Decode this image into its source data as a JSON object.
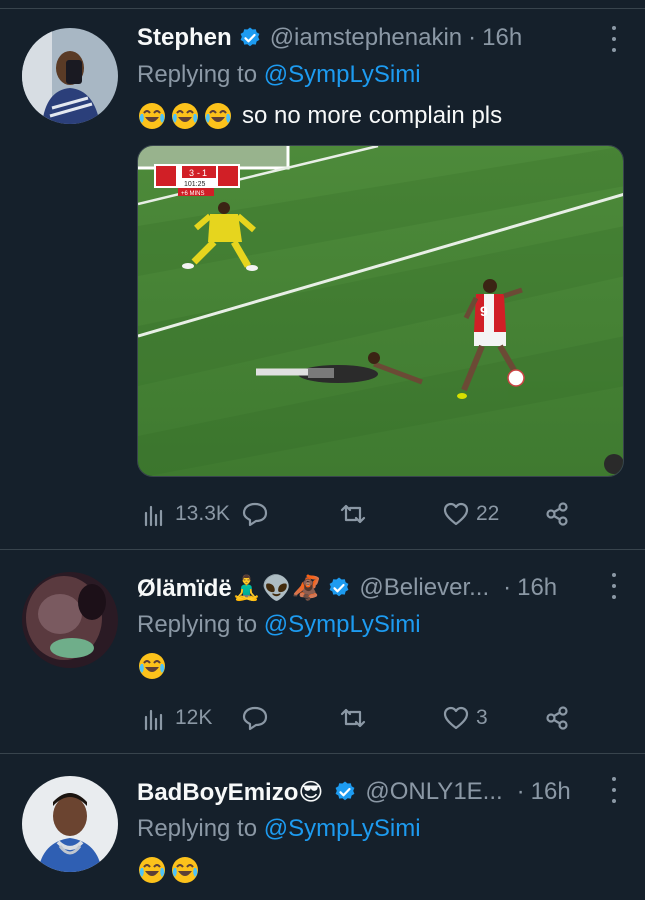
{
  "tweets": [
    {
      "name": "Stephen",
      "handle": "@iamstephenakin",
      "dot": "·",
      "time": "16h",
      "replying_prefix": "Replying to ",
      "replying_to": "@SympLySimi",
      "emoji_count": 3,
      "text": "so no more complain pls",
      "media": {
        "scoreboard_home": "3",
        "scoreboard_away": "1",
        "scoreboard_clock": "101:25",
        "scoreboard_added": "+6 MINS",
        "player_number": "9"
      },
      "stats": {
        "views": "13.3K",
        "replies": "",
        "retweets": "",
        "likes": "22"
      }
    },
    {
      "name": "Ølämïdë🧘‍♂️👽🦧",
      "handle": "@Believer...",
      "dot": "·",
      "time": "16h",
      "replying_prefix": "Replying to ",
      "replying_to": "@SympLySimi",
      "emoji_count": 1,
      "text": "",
      "stats": {
        "views": "12K",
        "replies": "",
        "retweets": "",
        "likes": "3"
      }
    },
    {
      "name": "BadBoyEmizo😎",
      "handle": "@ONLY1E...",
      "dot": "·",
      "time": "16h",
      "replying_prefix": "Replying to ",
      "replying_to": "@SympLySimi",
      "emoji_count": 2,
      "text": ""
    }
  ],
  "colors": {
    "background": "#15202b",
    "divider": "#38444d",
    "muted": "#8b98a5",
    "accent": "#1d9bf0",
    "text": "#f7f9f9"
  },
  "icons": {
    "badge": "verified-badge-icon",
    "more": "more-options-icon",
    "views": "views-chart-icon",
    "reply": "reply-bubble-icon",
    "retweet": "retweet-icon",
    "like": "heart-icon",
    "share": "share-icon",
    "laugh": "face-with-tears-of-joy-icon"
  }
}
